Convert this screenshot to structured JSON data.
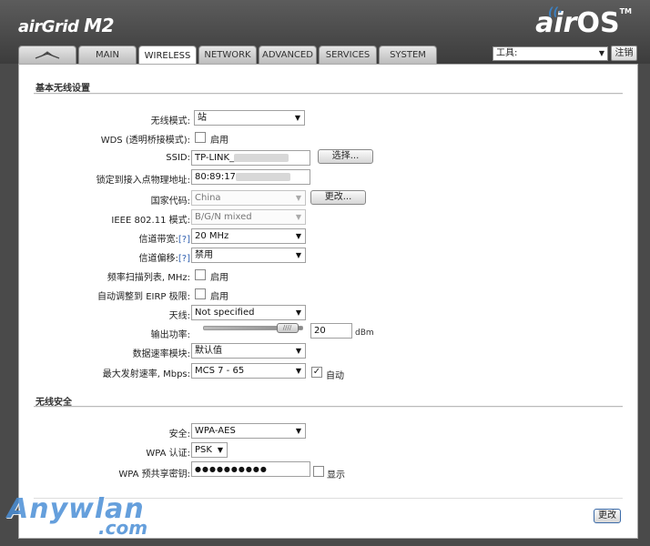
{
  "app": {
    "product_logo": "airGrid M2",
    "product_logo_main": "airGrid ",
    "product_logo_model": "M2",
    "brand_air": "air",
    "brand_os": "OS",
    "brand_tm": "TM"
  },
  "tabs": [
    {
      "label": "",
      "icon": "ubiquiti-antenna-icon"
    },
    {
      "label": "MAIN"
    },
    {
      "label": "WIRELESS",
      "active": true
    },
    {
      "label": "NETWORK"
    },
    {
      "label": "ADVANCED"
    },
    {
      "label": "SERVICES"
    },
    {
      "label": "SYSTEM"
    }
  ],
  "toolbar": {
    "tools_value": "工具:",
    "logout_label": "注销"
  },
  "basic": {
    "section_title": "基本无线设置",
    "wireless_mode_label": "无线模式:",
    "wireless_mode_value": "站",
    "wds_label": "WDS (透明桥接模式):",
    "wds_check_label": "启用",
    "ssid_label": "SSID:",
    "ssid_value": "TP-LINK_",
    "select_button": "选择...",
    "lock_ap_label": "锁定到接入点物理地址:",
    "lock_ap_value": "80:89:17",
    "country_label": "国家代码:",
    "country_value": "China",
    "change_button": "更改...",
    "ieee_label": "IEEE 802.11 模式:",
    "ieee_value": "B/G/N mixed",
    "channel_width_label": "信道带宽:",
    "channel_width_help": "[?]",
    "channel_width_value": "20 MHz",
    "channel_shift_label": "信道偏移:",
    "channel_shift_help": "[?]",
    "channel_shift_value": "禁用",
    "scan_list_label": "频率扫描列表, MHz:",
    "scan_list_check_label": "启用",
    "eirp_label": "自动调整到 EIRP 极限:",
    "eirp_check_label": "启用",
    "antenna_label": "天线:",
    "antenna_value": "Not specified",
    "output_power_label": "输出功率:",
    "output_power_value": "20",
    "output_power_unit": "dBm",
    "output_power_level": 0.95,
    "rate_module_label": "数据速率模块:",
    "rate_module_value": "默认值",
    "max_rate_label": "最大发射速率, Mbps:",
    "max_rate_value": "MCS 7 - 65",
    "auto_label": "自动",
    "auto_checked": true
  },
  "security": {
    "section_title": "无线安全",
    "security_label": "安全:",
    "security_value": "WPA-AES",
    "wpa_auth_label": "WPA 认证:",
    "wpa_auth_value": "PSK",
    "psk_label": "WPA 预共享密钥:",
    "psk_value": "●●●●●●●●●●",
    "show_label": "显示"
  },
  "footer": {
    "change_button": "更改"
  },
  "watermark": {
    "main": "Anywlan",
    "domain": ".com"
  }
}
